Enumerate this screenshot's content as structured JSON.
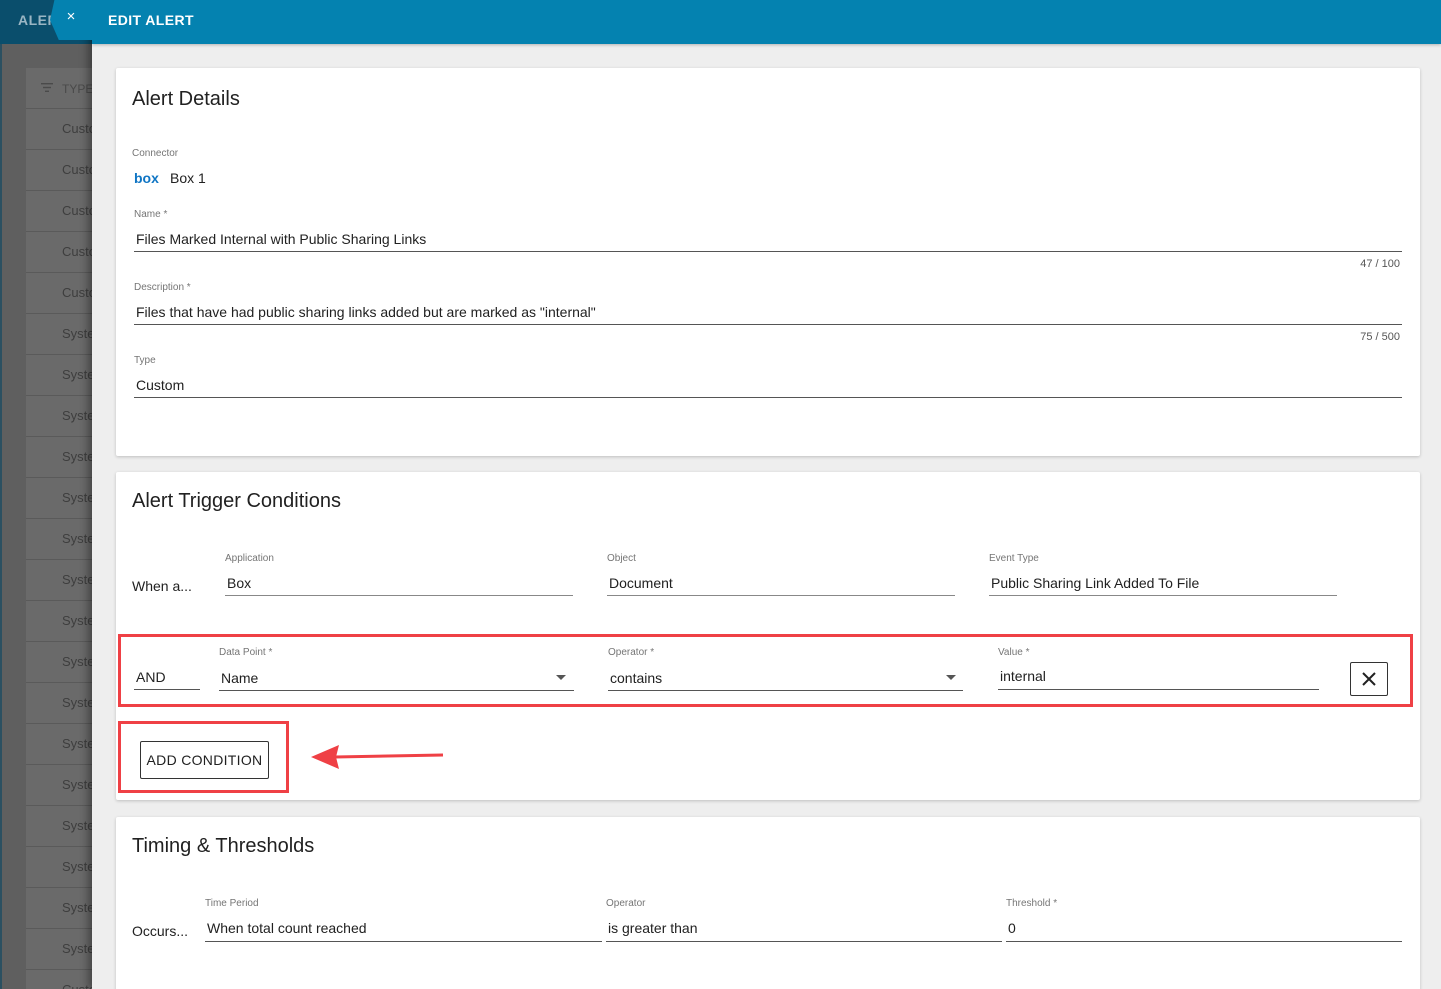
{
  "background": {
    "title": "ALER",
    "list_header": "TYPE",
    "rows": [
      "Custo",
      "Custo",
      "Custo",
      "Custo",
      "Custo",
      "Syste",
      "Syste",
      "Syste",
      "Syste",
      "Syste",
      "Syste",
      "Syste",
      "Syste",
      "Syste",
      "Syste",
      "Syste",
      "Syste",
      "Syste",
      "Syste",
      "Syste",
      "Syste",
      "Custo"
    ]
  },
  "drawer": {
    "title": "EDIT ALERT",
    "close_icon": "×"
  },
  "alert_details": {
    "title": "Alert Details",
    "connector": {
      "label": "Connector",
      "value": "Box 1",
      "logo_text": "box"
    },
    "name": {
      "label": "Name *",
      "value": "Files Marked Internal with Public Sharing Links",
      "counter": "47 / 100"
    },
    "description": {
      "label": "Description *",
      "value": "Files that have had public sharing links added but are marked as \"internal\"",
      "counter": "75 / 500"
    },
    "type": {
      "label": "Type",
      "value": "Custom"
    }
  },
  "trigger": {
    "title": "Alert Trigger Conditions",
    "when_label": "When a...",
    "application": {
      "label": "Application",
      "value": "Box"
    },
    "object": {
      "label": "Object",
      "value": "Document"
    },
    "event_type": {
      "label": "Event Type",
      "value": "Public Sharing Link Added To File"
    },
    "condition": {
      "conjunction": "AND",
      "data_point": {
        "label": "Data Point *",
        "value": "Name"
      },
      "operator": {
        "label": "Operator *",
        "value": "contains"
      },
      "value": {
        "label": "Value *",
        "value": "internal"
      }
    },
    "add_condition_label": "ADD CONDITION"
  },
  "timing": {
    "title": "Timing & Thresholds",
    "occurs_label": "Occurs...",
    "time_period": {
      "label": "Time Period",
      "value": "When total count reached"
    },
    "operator": {
      "label": "Operator",
      "value": "is greater than"
    },
    "threshold": {
      "label": "Threshold *",
      "value": "0"
    }
  },
  "colors": {
    "header": "#0482b0",
    "highlight": "#ef4045",
    "box_logo": "#0f75c4"
  }
}
